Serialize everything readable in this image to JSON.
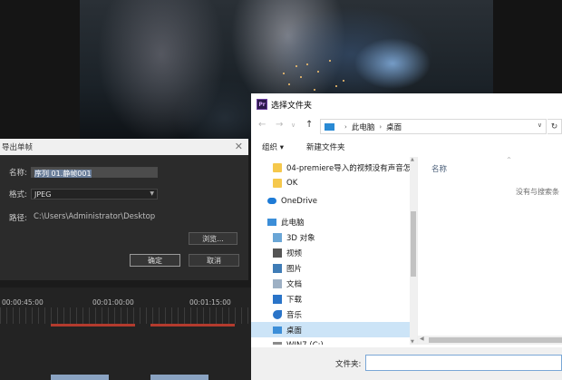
{
  "video": {
    "sparks": [
      [
        250,
        70
      ],
      [
        262,
        78
      ],
      [
        243,
        84
      ],
      [
        275,
        66
      ],
      [
        230,
        92
      ],
      [
        290,
        88
      ],
      [
        258,
        98
      ],
      [
        238,
        72
      ],
      [
        282,
        94
      ],
      [
        224,
        80
      ]
    ]
  },
  "export_dialog": {
    "title": "导出单帧",
    "name_label": "名称:",
    "name_value": "序列 01.静帧001",
    "format_label": "格式:",
    "format_value": "JPEG",
    "path_label": "路径:",
    "path_value": "C:\\Users\\Administrator\\Desktop",
    "browse_label": "浏览...",
    "ok_label": "确定",
    "cancel_label": "取消"
  },
  "timeline": {
    "timecodes": [
      "00:00:45:00",
      "00:01:00:00",
      "00:01:15:00"
    ]
  },
  "file_dialog": {
    "title": "选择文件夹",
    "app_icon": "Pr",
    "address": {
      "root": "此电脑",
      "current": "桌面"
    },
    "toolbar": {
      "organize": "组织 ▾",
      "new_folder": "新建文件夹"
    },
    "nav_items": [
      {
        "label": "04-premiere导入的视频没有声音怎",
        "icon": "folder-icon"
      },
      {
        "label": "OK",
        "icon": "folder-icon"
      },
      {
        "label": "OneDrive",
        "icon": "cloud-icon"
      },
      {
        "label": "此电脑",
        "icon": "computer-icon"
      },
      {
        "label": "3D 对象",
        "icon": "3d-objects-icon"
      },
      {
        "label": "视频",
        "icon": "videos-icon"
      },
      {
        "label": "图片",
        "icon": "pictures-icon"
      },
      {
        "label": "文档",
        "icon": "documents-icon"
      },
      {
        "label": "下载",
        "icon": "downloads-icon"
      },
      {
        "label": "音乐",
        "icon": "music-icon"
      },
      {
        "label": "桌面",
        "icon": "desktop-icon",
        "selected": true
      },
      {
        "label": "WIN7 (C:)",
        "icon": "drive-icon"
      }
    ],
    "column_name": "名称",
    "empty_text": "没有与搜索条",
    "filename_label": "文件夹:",
    "filename_value": ""
  }
}
